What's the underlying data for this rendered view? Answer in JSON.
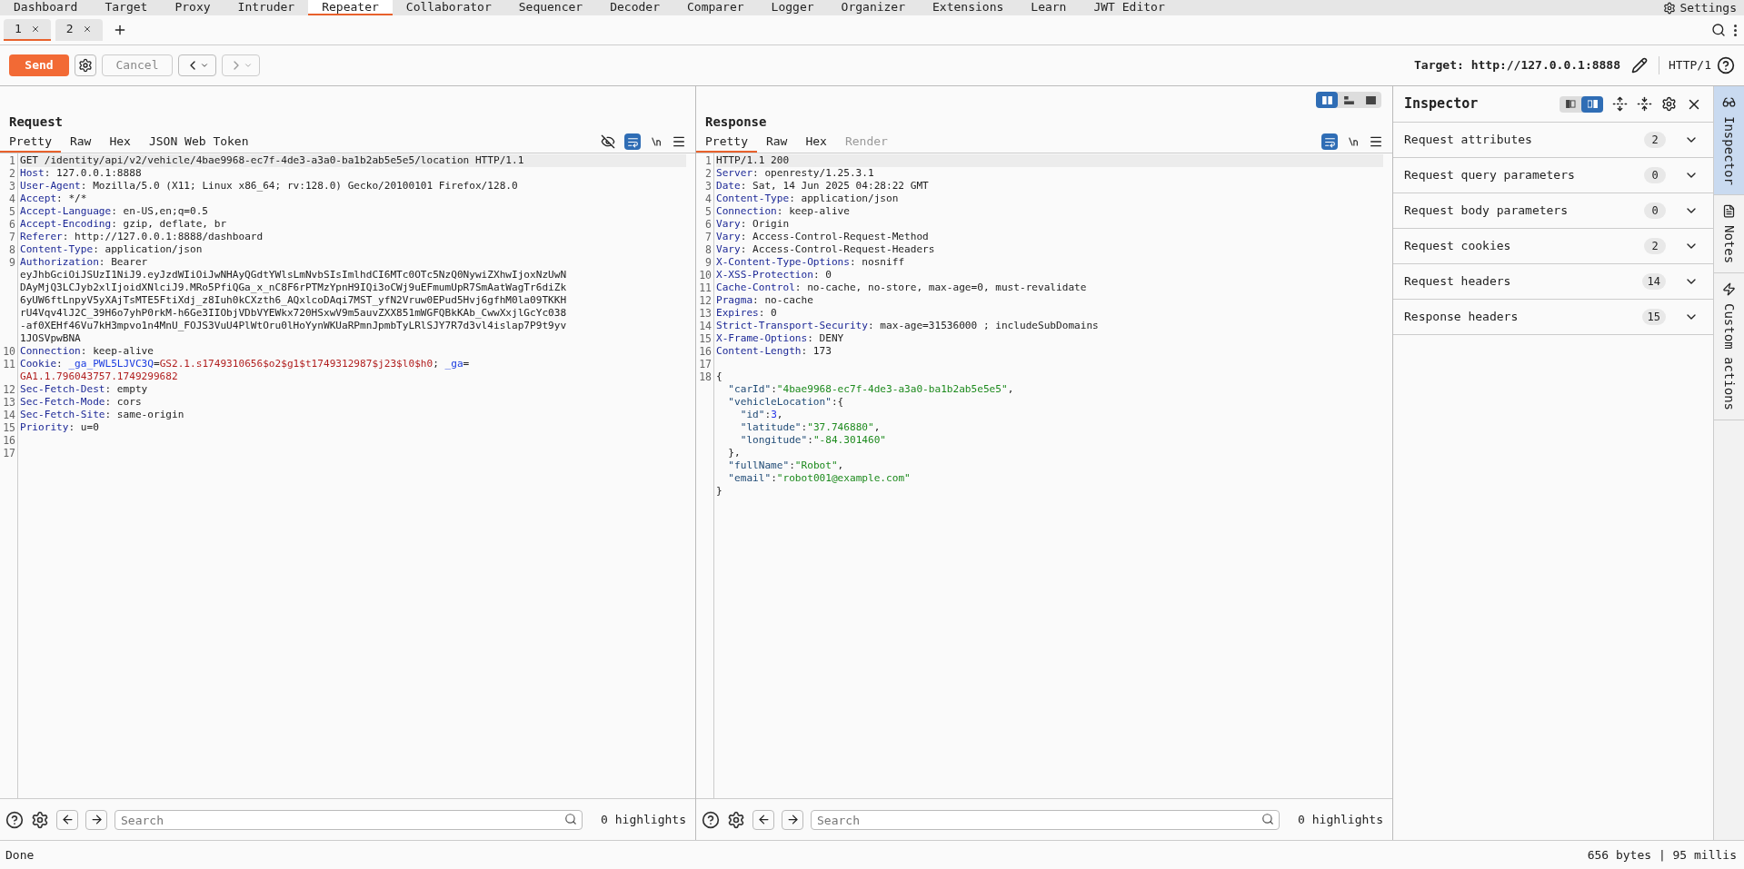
{
  "menu": [
    {
      "label": "Dashboard",
      "selected": false
    },
    {
      "label": "Target",
      "selected": false
    },
    {
      "label": "Proxy",
      "selected": false
    },
    {
      "label": "Intruder",
      "selected": false
    },
    {
      "label": "Repeater",
      "selected": true
    },
    {
      "label": "Collaborator",
      "selected": false
    },
    {
      "label": "Sequencer",
      "selected": false
    },
    {
      "label": "Decoder",
      "selected": false
    },
    {
      "label": "Comparer",
      "selected": false
    },
    {
      "label": "Logger",
      "selected": false
    },
    {
      "label": "Organizer",
      "selected": false
    },
    {
      "label": "Extensions",
      "selected": false
    },
    {
      "label": "Learn",
      "selected": false
    },
    {
      "label": "JWT Editor",
      "selected": false
    }
  ],
  "settings": "Settings",
  "repeater_tabs": [
    {
      "label": "1",
      "selected": true
    },
    {
      "label": "2",
      "selected": false
    }
  ],
  "toolbar": {
    "send": "Send",
    "cancel": "Cancel",
    "target": "Target: http://127.0.0.1:8888",
    "protocol": "HTTP/1"
  },
  "layout_views": [
    {
      "selected": true
    },
    {
      "selected": false
    },
    {
      "selected": false
    }
  ],
  "request": {
    "title": "Request",
    "tabs": [
      {
        "label": "Pretty",
        "selected": true,
        "disabled": false
      },
      {
        "label": "Raw",
        "selected": false,
        "disabled": false
      },
      {
        "label": "Hex",
        "selected": false,
        "disabled": false
      },
      {
        "label": "JSON Web Token",
        "selected": false,
        "disabled": false
      }
    ],
    "lines": [
      {
        "number": "1",
        "highlighted": true,
        "segments": [
          {
            "kind": "text",
            "text": "GET /identity/api/v2/vehicle/4bae9968-ec7f-4de3-a3a0-ba1b2ab5e5e5/location HTTP/1.1"
          }
        ]
      },
      {
        "number": "2",
        "highlighted": false,
        "segments": [
          {
            "kind": "key",
            "text": "Host"
          },
          {
            "kind": "text",
            "text": ": 127.0.0.1:8888"
          }
        ]
      },
      {
        "number": "3",
        "highlighted": false,
        "segments": [
          {
            "kind": "key",
            "text": "User-Agent"
          },
          {
            "kind": "text",
            "text": ": Mozilla/5.0 (X11; Linux x86_64; rv:128.0) Gecko/20100101 Firefox/128.0"
          }
        ]
      },
      {
        "number": "4",
        "highlighted": false,
        "segments": [
          {
            "kind": "key",
            "text": "Accept"
          },
          {
            "kind": "text",
            "text": ": */*"
          }
        ]
      },
      {
        "number": "5",
        "highlighted": false,
        "segments": [
          {
            "kind": "key",
            "text": "Accept-Language"
          },
          {
            "kind": "text",
            "text": ": en-US,en;q=0.5"
          }
        ]
      },
      {
        "number": "6",
        "highlighted": false,
        "segments": [
          {
            "kind": "key",
            "text": "Accept-Encoding"
          },
          {
            "kind": "text",
            "text": ": gzip, deflate, br"
          }
        ]
      },
      {
        "number": "7",
        "highlighted": false,
        "segments": [
          {
            "kind": "key",
            "text": "Referer"
          },
          {
            "kind": "text",
            "text": ": http://127.0.0.1:8888/dashboard"
          }
        ]
      },
      {
        "number": "8",
        "highlighted": false,
        "segments": [
          {
            "kind": "key",
            "text": "Content-Type"
          },
          {
            "kind": "text",
            "text": ": application/json"
          }
        ]
      },
      {
        "number": "9",
        "highlighted": false,
        "segments": [
          {
            "kind": "key",
            "text": "Authorization"
          },
          {
            "kind": "text",
            "text": ": Bearer"
          }
        ]
      },
      {
        "highlighted": false,
        "segments": [
          {
            "kind": "text",
            "text": "eyJhbGciOiJSUzI1NiJ9.eyJzdWIiOiJwNHAyQGdtYWlsLmNvbSIsImlhdCI6MTc0OTc5NzQ0NywiZXhwIjoxNzUwN"
          }
        ]
      },
      {
        "highlighted": false,
        "segments": [
          {
            "kind": "text",
            "text": "DAyMjQ3LCJyb2xlIjoidXNlciJ9.MRo5PfiQGa_x_nC8F6rPTMzYpnH9IQi3oCWj9uEFmumUpR7SmAatWagTr6diZk"
          }
        ]
      },
      {
        "highlighted": false,
        "segments": [
          {
            "kind": "text",
            "text": "6yUW6ftLnpyV5yXAjTsMTE5FtiXdj_z8Iuh0kCXzth6_AQxlcoDAqi7MST_yfN2Vruw0EPud5Hvj6gfhM0la09TKKH"
          }
        ]
      },
      {
        "highlighted": false,
        "segments": [
          {
            "kind": "text",
            "text": "rU4Vqv4lJ2C_39H6o7yhP0rkM-h6Ge3IIObjVDbVYEWkx720HSxwV9m5auvZXX851mWGFQBkKAb_CwwXxjlGcYc038"
          }
        ]
      },
      {
        "highlighted": false,
        "segments": [
          {
            "kind": "text",
            "text": "-af0XEHf46Vu7kH3mpvo1n4MnU_FOJS3VuU4PlWtOru0lHoYynWKUaRPmnJpmbTyLRlSJY7R7d3vl4islap7P9t9yv"
          }
        ]
      },
      {
        "highlighted": false,
        "segments": [
          {
            "kind": "text",
            "text": "1JOSVpwBNA"
          }
        ]
      },
      {
        "number": "10",
        "highlighted": false,
        "segments": [
          {
            "kind": "key",
            "text": "Connection"
          },
          {
            "kind": "text",
            "text": ": keep-alive"
          }
        ]
      },
      {
        "number": "11",
        "highlighted": false,
        "segments": [
          {
            "kind": "key",
            "text": "Cookie"
          },
          {
            "kind": "text",
            "text": ": "
          },
          {
            "kind": "cookie-name",
            "text": "_ga_PWL5LJVC3Q"
          },
          {
            "kind": "text",
            "text": "="
          },
          {
            "kind": "cookie-value",
            "text": "GS2.1.s1749310656$o2$g1$t1749312987$j23$l0$h0"
          },
          {
            "kind": "text",
            "text": "; "
          },
          {
            "kind": "cookie-name",
            "text": "_ga"
          },
          {
            "kind": "text",
            "text": "="
          }
        ]
      },
      {
        "highlighted": false,
        "segments": [
          {
            "kind": "cookie-value",
            "text": "GA1.1.796043757.1749299682"
          }
        ]
      },
      {
        "number": "12",
        "highlighted": false,
        "segments": [
          {
            "kind": "key",
            "text": "Sec-Fetch-Dest"
          },
          {
            "kind": "text",
            "text": ": empty"
          }
        ]
      },
      {
        "number": "13",
        "highlighted": false,
        "segments": [
          {
            "kind": "key",
            "text": "Sec-Fetch-Mode"
          },
          {
            "kind": "text",
            "text": ": cors"
          }
        ]
      },
      {
        "number": "14",
        "highlighted": false,
        "segments": [
          {
            "kind": "key",
            "text": "Sec-Fetch-Site"
          },
          {
            "kind": "text",
            "text": ": same-origin"
          }
        ]
      },
      {
        "number": "15",
        "highlighted": false,
        "segments": [
          {
            "kind": "key",
            "text": "Priority"
          },
          {
            "kind": "text",
            "text": ": u=0"
          }
        ]
      },
      {
        "number": "16",
        "highlighted": false
      },
      {
        "number": "17",
        "highlighted": false
      }
    ],
    "search": {
      "placeholder": "Search"
    },
    "highlights": "0 highlights"
  },
  "response": {
    "title": "Response",
    "tabs": [
      {
        "label": "Pretty",
        "selected": true,
        "disabled": false
      },
      {
        "label": "Raw",
        "selected": false,
        "disabled": false
      },
      {
        "label": "Hex",
        "selected": false,
        "disabled": false
      },
      {
        "label": "Render",
        "selected": false,
        "disabled": true
      }
    ],
    "lines": [
      {
        "number": "1",
        "highlighted": true,
        "segments": [
          {
            "kind": "text",
            "text": "HTTP/1.1 200"
          }
        ]
      },
      {
        "number": "2",
        "highlighted": false,
        "segments": [
          {
            "kind": "key",
            "text": "Server"
          },
          {
            "kind": "text",
            "text": ": openresty/1.25.3.1"
          }
        ]
      },
      {
        "number": "3",
        "highlighted": false,
        "segments": [
          {
            "kind": "key",
            "text": "Date"
          },
          {
            "kind": "text",
            "text": ": Sat, 14 Jun 2025 04:28:22 GMT"
          }
        ]
      },
      {
        "number": "4",
        "highlighted": false,
        "segments": [
          {
            "kind": "key",
            "text": "Content-Type"
          },
          {
            "kind": "text",
            "text": ": application/json"
          }
        ]
      },
      {
        "number": "5",
        "highlighted": false,
        "segments": [
          {
            "kind": "key",
            "text": "Connection"
          },
          {
            "kind": "text",
            "text": ": keep-alive"
          }
        ]
      },
      {
        "number": "6",
        "highlighted": false,
        "segments": [
          {
            "kind": "key",
            "text": "Vary"
          },
          {
            "kind": "text",
            "text": ": Origin"
          }
        ]
      },
      {
        "number": "7",
        "highlighted": false,
        "segments": [
          {
            "kind": "key",
            "text": "Vary"
          },
          {
            "kind": "text",
            "text": ": Access-Control-Request-Method"
          }
        ]
      },
      {
        "number": "8",
        "highlighted": false,
        "segments": [
          {
            "kind": "key",
            "text": "Vary"
          },
          {
            "kind": "text",
            "text": ": Access-Control-Request-Headers"
          }
        ]
      },
      {
        "number": "9",
        "highlighted": false,
        "segments": [
          {
            "kind": "key",
            "text": "X-Content-Type-Options"
          },
          {
            "kind": "text",
            "text": ": nosniff"
          }
        ]
      },
      {
        "number": "10",
        "highlighted": false,
        "segments": [
          {
            "kind": "key",
            "text": "X-XSS-Protection"
          },
          {
            "kind": "text",
            "text": ": 0"
          }
        ]
      },
      {
        "number": "11",
        "highlighted": false,
        "segments": [
          {
            "kind": "key",
            "text": "Cache-Control"
          },
          {
            "kind": "text",
            "text": ": no-cache, no-store, max-age=0, must-revalidate"
          }
        ]
      },
      {
        "number": "12",
        "highlighted": false,
        "segments": [
          {
            "kind": "key",
            "text": "Pragma"
          },
          {
            "kind": "text",
            "text": ": no-cache"
          }
        ]
      },
      {
        "number": "13",
        "highlighted": false,
        "segments": [
          {
            "kind": "key",
            "text": "Expires"
          },
          {
            "kind": "text",
            "text": ": 0"
          }
        ]
      },
      {
        "number": "14",
        "highlighted": false,
        "segments": [
          {
            "kind": "key",
            "text": "Strict-Transport-Security"
          },
          {
            "kind": "text",
            "text": ": max-age=31536000 ; includeSubDomains"
          }
        ]
      },
      {
        "number": "15",
        "highlighted": false,
        "segments": [
          {
            "kind": "key",
            "text": "X-Frame-Options"
          },
          {
            "kind": "text",
            "text": ": DENY"
          }
        ]
      },
      {
        "number": "16",
        "highlighted": false,
        "segments": [
          {
            "kind": "key",
            "text": "Content-Length"
          },
          {
            "kind": "text",
            "text": ": 173"
          }
        ]
      },
      {
        "number": "17",
        "highlighted": false
      },
      {
        "number": "18",
        "highlighted": false,
        "segments": [
          {
            "kind": "text",
            "text": "{"
          }
        ]
      },
      {
        "highlighted": false,
        "segments": [
          {
            "kind": "json-key",
            "text": "  \"carId\""
          },
          {
            "kind": "text",
            "text": ":"
          },
          {
            "kind": "string",
            "text": "\"4bae9968-ec7f-4de3-a3a0-ba1b2ab5e5e5\""
          },
          {
            "kind": "text",
            "text": ","
          }
        ]
      },
      {
        "highlighted": false,
        "segments": [
          {
            "kind": "json-key",
            "text": "  \"vehicleLocation\""
          },
          {
            "kind": "text",
            "text": ":{"
          }
        ]
      },
      {
        "highlighted": false,
        "segments": [
          {
            "kind": "json-key",
            "text": "    \"id\""
          },
          {
            "kind": "text",
            "text": ":"
          },
          {
            "kind": "number",
            "text": "3"
          },
          {
            "kind": "text",
            "text": ","
          }
        ]
      },
      {
        "highlighted": false,
        "segments": [
          {
            "kind": "json-key",
            "text": "    \"latitude\""
          },
          {
            "kind": "text",
            "text": ":"
          },
          {
            "kind": "string",
            "text": "\"37.746880\""
          },
          {
            "kind": "text",
            "text": ","
          }
        ]
      },
      {
        "highlighted": false,
        "segments": [
          {
            "kind": "json-key",
            "text": "    \"longitude\""
          },
          {
            "kind": "text",
            "text": ":"
          },
          {
            "kind": "string",
            "text": "\"-84.301460\""
          }
        ]
      },
      {
        "highlighted": false,
        "segments": [
          {
            "kind": "text",
            "text": "  },"
          }
        ]
      },
      {
        "highlighted": false,
        "segments": [
          {
            "kind": "json-key",
            "text": "  \"fullName\""
          },
          {
            "kind": "text",
            "text": ":"
          },
          {
            "kind": "string",
            "text": "\"Robot\""
          },
          {
            "kind": "text",
            "text": ","
          }
        ]
      },
      {
        "highlighted": false,
        "segments": [
          {
            "kind": "json-key",
            "text": "  \"email\""
          },
          {
            "kind": "text",
            "text": ":"
          },
          {
            "kind": "string",
            "text": "\"robot001@example.com\""
          }
        ]
      },
      {
        "highlighted": false,
        "segments": [
          {
            "kind": "text",
            "text": "}"
          }
        ]
      }
    ],
    "search": {
      "placeholder": "Search"
    },
    "highlights": "0 highlights"
  },
  "inspector": {
    "title": "Inspector",
    "views": [
      {
        "selected": false
      },
      {
        "selected": true
      }
    ],
    "sections": [
      {
        "label": "Request attributes",
        "count": "2"
      },
      {
        "label": "Request query parameters",
        "count": "0"
      },
      {
        "label": "Request body parameters",
        "count": "0"
      },
      {
        "label": "Request cookies",
        "count": "2"
      },
      {
        "label": "Request headers",
        "count": "14"
      },
      {
        "label": "Response headers",
        "count": "15"
      }
    ]
  },
  "side_rail": [
    {
      "kind": "inspector",
      "label": "Inspector",
      "selected": true
    },
    {
      "kind": "notes",
      "label": "Notes",
      "selected": false
    },
    {
      "kind": "actions",
      "label": "Custom actions",
      "selected": false
    }
  ],
  "status_bar": {
    "message": "Done",
    "stats": "656 bytes | 95 millis"
  }
}
